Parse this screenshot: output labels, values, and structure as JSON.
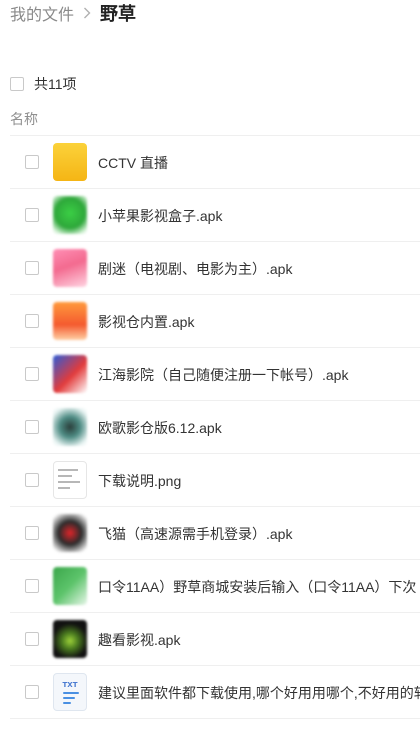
{
  "breadcrumb": {
    "root": "我的文件",
    "current": "野草"
  },
  "select_all": {
    "label": "共11项"
  },
  "column_header": {
    "name": "名称"
  },
  "files": [
    {
      "name": "CCTV  直播",
      "icon": "folder-icon"
    },
    {
      "name": "小苹果影视盒子.apk",
      "icon": "app-icon-green"
    },
    {
      "name": "剧迷（电视剧、电影为主）.apk",
      "icon": "app-icon-pink"
    },
    {
      "name": "影视仓内置.apk",
      "icon": "app-icon-orange"
    },
    {
      "name": "江海影院（自己随便注册一下帐号）.apk",
      "icon": "app-icon-redblue"
    },
    {
      "name": "欧歌影仓版6.12.apk",
      "icon": "app-icon-teal"
    },
    {
      "name": "下载说明.png",
      "icon": "image-file-icon"
    },
    {
      "name": "飞猫（高速源需手机登录）.apk",
      "icon": "app-icon-dark"
    },
    {
      "name": "口令11AA）野草商城安装后输入（口令11AA）下次",
      "icon": "app-icon-green2"
    },
    {
      "name": "趣看影视.apk",
      "icon": "app-icon-black"
    },
    {
      "name": "建议里面软件都下载使用,哪个好用用哪个,不好用的软",
      "icon": "txt-file-icon"
    }
  ]
}
